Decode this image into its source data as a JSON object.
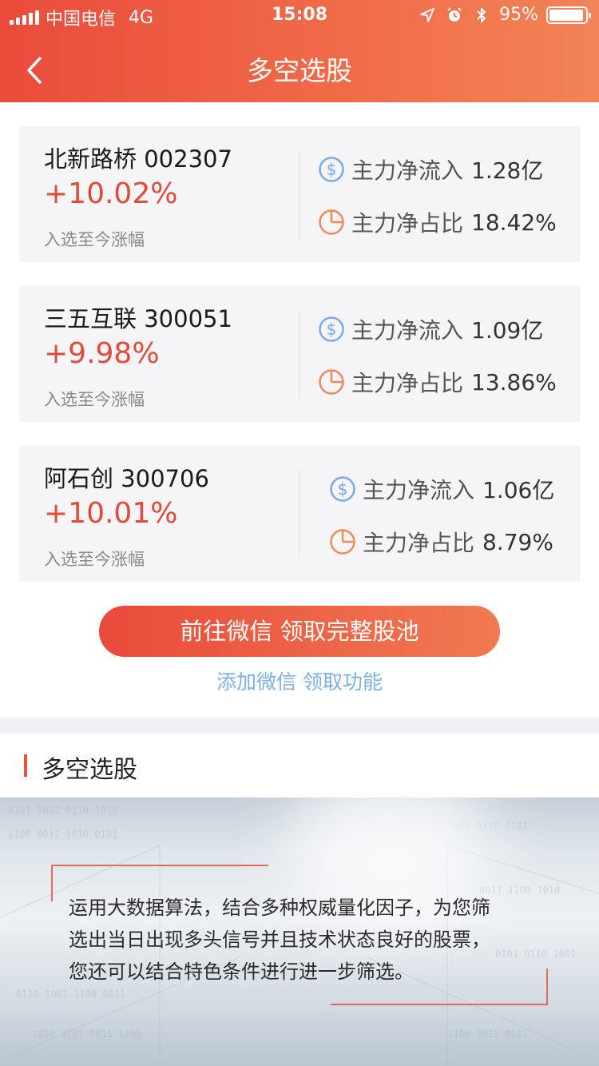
{
  "status_bar": {
    "carrier": "中国电信",
    "network": "4G",
    "time": "15:08",
    "battery": "95%",
    "battery_level": 0.95
  },
  "nav": {
    "title": "多空选股",
    "back_icon": "chevron-left-icon"
  },
  "stocks": [
    {
      "name": "北新路桥 002307",
      "change": "+10.02%",
      "change_label": "入选至今涨幅",
      "inflow_label": "主力净流入",
      "inflow_value": "1.28亿",
      "ratio_label": "主力净占比",
      "ratio_value": "18.42%"
    },
    {
      "name": "三五互联 300051",
      "change": "+9.98%",
      "change_label": "入选至今涨幅",
      "inflow_label": "主力净流入",
      "inflow_value": "1.09亿",
      "ratio_label": "主力净占比",
      "ratio_value": "13.86%"
    },
    {
      "name": "阿石创 300706",
      "change": "+10.01%",
      "change_label": "入选至今涨幅",
      "inflow_label": "主力净流入",
      "inflow_value": "1.06亿",
      "ratio_label": "主力净占比",
      "ratio_value": "8.79%"
    }
  ],
  "cta": {
    "label": "前往微信 领取完整股池",
    "link": "添加微信 领取功能"
  },
  "section": {
    "title": "多空选股"
  },
  "banner": {
    "lines": [
      "运用大数据算法，结合多种权威量化因子，为您筛",
      "选出当日出现多头信号并且技术状态良好的股票，",
      "您还可以结合特色条件进行进一步筛选。"
    ]
  },
  "colors": {
    "accent_red": "#e24a3b",
    "link_blue": "#7fb0e4",
    "icon_blue": "#7aa8e8",
    "icon_orange": "#f08a5a"
  }
}
